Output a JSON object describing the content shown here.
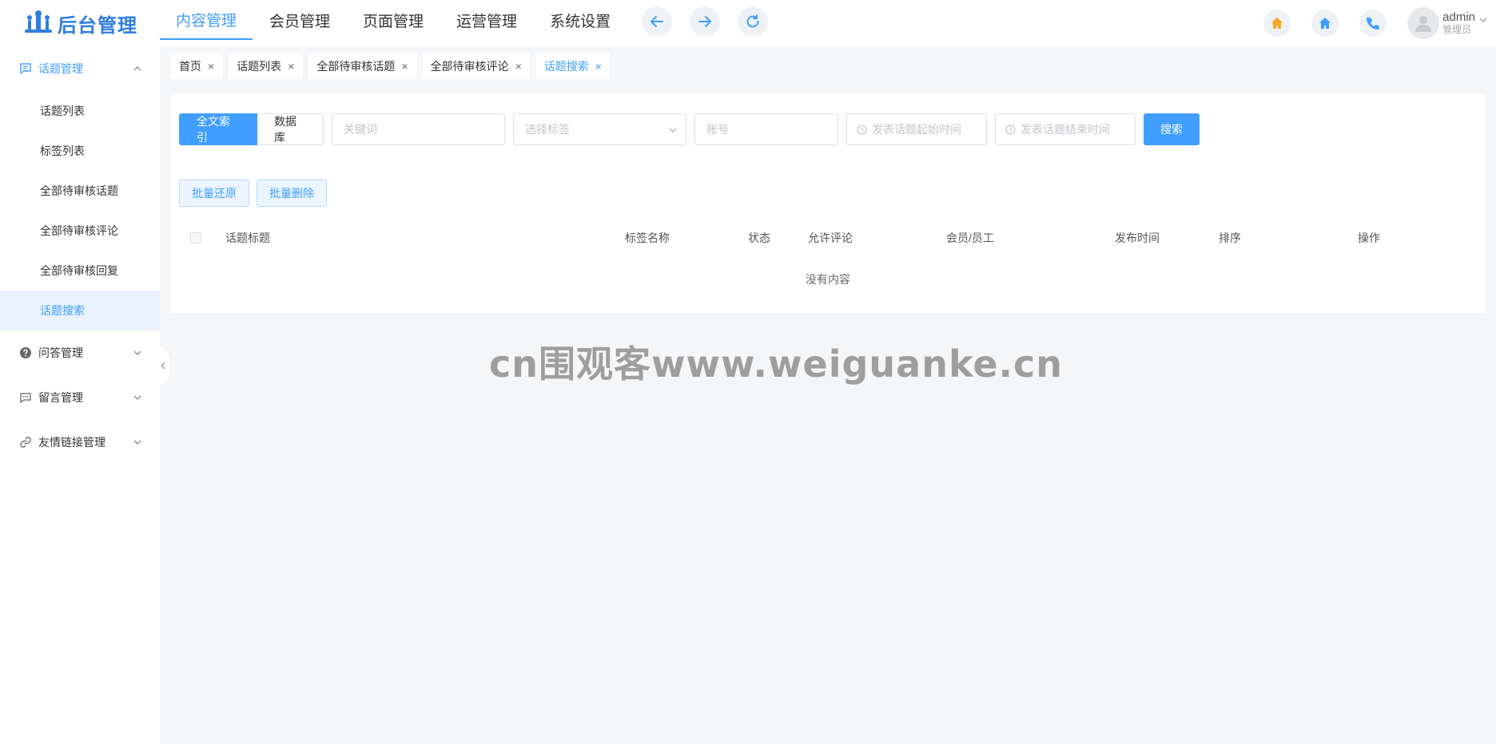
{
  "app": {
    "logo_text": "后台管理"
  },
  "topnav": {
    "items": [
      {
        "label": "内容管理",
        "active": true
      },
      {
        "label": "会员管理"
      },
      {
        "label": "页面管理"
      },
      {
        "label": "运营管理"
      },
      {
        "label": "系统设置"
      }
    ],
    "buttons": [
      "arrow-left-icon",
      "arrow-right-icon",
      "refresh-icon"
    ]
  },
  "header_right": {
    "icons": [
      "home-icon",
      "home-icon",
      "phone-icon"
    ],
    "user": {
      "name": "admin",
      "role": "管理员"
    }
  },
  "sidebar": {
    "groups": [
      {
        "label": "话题管理",
        "icon": "message-square-icon",
        "expanded": true,
        "active": true,
        "items": [
          {
            "label": "话题列表"
          },
          {
            "label": "标签列表"
          },
          {
            "label": "全部待审核话题"
          },
          {
            "label": "全部待审核评论"
          },
          {
            "label": "全部待审核回复"
          },
          {
            "label": "话题搜索",
            "active": true
          }
        ]
      },
      {
        "label": "问答管理",
        "icon": "question-circle-icon"
      },
      {
        "label": "留言管理",
        "icon": "chat-bubble-icon"
      },
      {
        "label": "友情链接管理",
        "icon": "link-icon"
      }
    ]
  },
  "tabs": [
    {
      "label": "首页"
    },
    {
      "label": "话题列表"
    },
    {
      "label": "全部待审核话题"
    },
    {
      "label": "全部待审核评论"
    },
    {
      "label": "话题搜索",
      "active": true
    }
  ],
  "search": {
    "mode_fulltext": "全文索引",
    "mode_database": "数据库",
    "keyword_placeholder": "关键词",
    "tag_placeholder": "选择标签",
    "account_placeholder": "账号",
    "start_placeholder": "发表话题起始时间",
    "end_placeholder": "发表话题结束时间",
    "search_label": "搜索"
  },
  "batch": {
    "restore_label": "批量还原",
    "delete_label": "批量删除"
  },
  "table": {
    "columns": [
      "话题标题",
      "标签名称",
      "状态",
      "允许评论",
      "会员/员工",
      "发布时间",
      "排序",
      "操作"
    ],
    "empty_text": "没有内容"
  },
  "watermark": "cn围观客www.weiguanke.cn",
  "colors": {
    "accent": "#409eff",
    "logo": "#2f7de1",
    "home_icon_orange": "#f5a623"
  }
}
